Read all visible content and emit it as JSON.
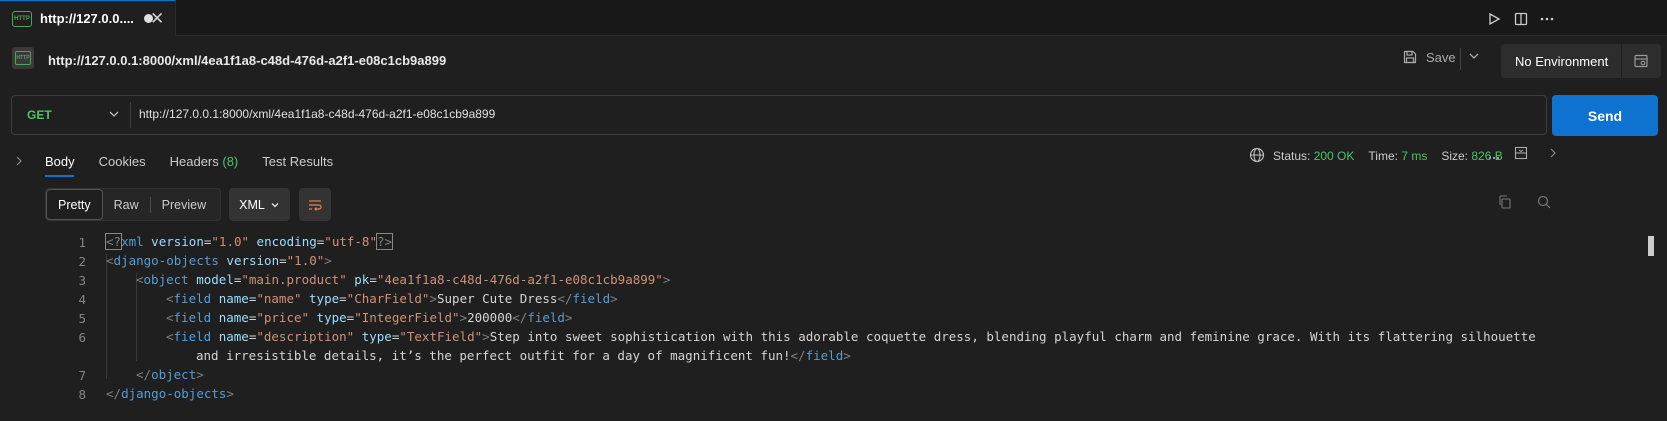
{
  "tab": {
    "title": "http://127.0.0....",
    "badge": "HTTP"
  },
  "request": {
    "name": "http://127.0.0.1:8000/xml/4ea1f1a8-c48d-476d-a2f1-e08c1cb9a899",
    "save_label": "Save",
    "environment": "No Environment"
  },
  "urlbar": {
    "method": "GET",
    "url": "http://127.0.0.1:8000/xml/4ea1f1a8-c48d-476d-a2f1-e08c1cb9a899",
    "send_label": "Send"
  },
  "response_tabs": {
    "body": "Body",
    "cookies": "Cookies",
    "headers": "Headers",
    "headers_count": "(8)",
    "test_results": "Test Results"
  },
  "status": {
    "status_label": "Status:",
    "status_value": "200 OK",
    "time_label": "Time:",
    "time_value": "7 ms",
    "size_label": "Size:",
    "size_value": "826 B"
  },
  "view": {
    "pretty": "Pretty",
    "raw": "Raw",
    "preview": "Preview",
    "format": "XML"
  },
  "code": {
    "line_numbers": [
      "1",
      "2",
      "3",
      "4",
      "5",
      "6",
      "",
      "7",
      "8"
    ],
    "l1_a": "<?",
    "l1_b": "xml",
    "l1_c": " version",
    "l1_d": "=",
    "l1_e": "\"1.0\"",
    "l1_f": " encoding",
    "l1_g": "=",
    "l1_h": "\"utf-8\"",
    "l1_i": "?>",
    "l2_a": "<",
    "l2_b": "django-objects",
    "l2_c": " version",
    "l2_d": "=",
    "l2_e": "\"1.0\"",
    "l2_f": ">",
    "l3_a": "<",
    "l3_b": "object",
    "l3_c": " model",
    "l3_d": "=",
    "l3_e": "\"main.product\"",
    "l3_f": " pk",
    "l3_g": "=",
    "l3_h": "\"4ea1f1a8-c48d-476d-a2f1-e08c1cb9a899\"",
    "l3_i": ">",
    "l4_a": "<",
    "l4_b": "field",
    "l4_c": " name",
    "l4_d": "=",
    "l4_e": "\"name\"",
    "l4_f": " type",
    "l4_g": "=",
    "l4_h": "\"CharField\"",
    "l4_i": ">",
    "l4_j": "Super Cute Dress",
    "l4_k": "</",
    "l4_l": "field",
    "l4_m": ">",
    "l5_a": "<",
    "l5_b": "field",
    "l5_c": " name",
    "l5_d": "=",
    "l5_e": "\"price\"",
    "l5_f": " type",
    "l5_g": "=",
    "l5_h": "\"IntegerField\"",
    "l5_i": ">",
    "l5_j": "200000",
    "l5_k": "</",
    "l5_l": "field",
    "l5_m": ">",
    "l6_a": "<",
    "l6_b": "field",
    "l6_c": " name",
    "l6_d": "=",
    "l6_e": "\"description\"",
    "l6_f": " type",
    "l6_g": "=",
    "l6_h": "\"TextField\"",
    "l6_i": ">",
    "l6_j": "Step into sweet sophistication with this adorable coquette dress, blending playful charm and feminine grace. With its flattering silhouette",
    "l6w_j": "and irresistible details, it’s the perfect outfit for a day of magnificent fun!",
    "l6w_k": "</",
    "l6w_l": "field",
    "l6w_m": ">",
    "l7_a": "</",
    "l7_b": "object",
    "l7_c": ">",
    "l8_a": "</",
    "l8_b": "django-objects",
    "l8_c": ">"
  },
  "colors": {
    "accent": "#0e72d0",
    "success": "#4ec36b",
    "tag": "#569cd6",
    "attr": "#9cdcfe",
    "string": "#ce9178"
  }
}
